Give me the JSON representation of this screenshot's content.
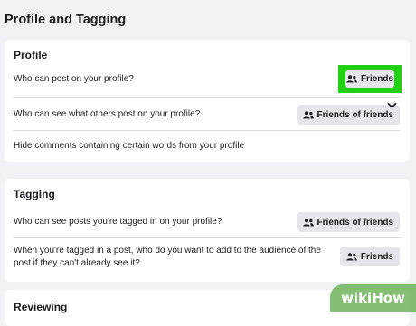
{
  "page": {
    "title": "Profile and Tagging"
  },
  "profile": {
    "title": "Profile",
    "rows": [
      {
        "label": "Who can post on your profile?",
        "value": "Friends"
      },
      {
        "label": "Who can see what others post on your profile?",
        "value": "Friends of friends"
      },
      {
        "label": "Hide comments containing certain words from your profile"
      }
    ]
  },
  "tagging": {
    "title": "Tagging",
    "rows": [
      {
        "label": "Who can see posts you're tagged in on your profile?",
        "value": "Friends of friends"
      },
      {
        "label_line1": "When you're tagged in a post, who do you want to add to the audience of the",
        "label_line2": "post if they can't already see it?",
        "value": "Friends"
      }
    ]
  },
  "reviewing": {
    "title": "Reviewing"
  },
  "watermark": {
    "text": "wikiHow"
  },
  "colors": {
    "highlight": "#22d016",
    "pill_bg": "#e4e6eb",
    "divider": "#dadde1",
    "background": "#f0f2f5"
  },
  "icons": {
    "audience": "people-icon",
    "expand": "chevron-down-icon"
  }
}
